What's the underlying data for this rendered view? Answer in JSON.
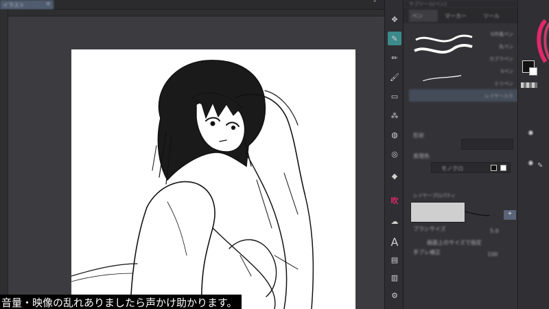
{
  "document_tab": {
    "title": "イラスト"
  },
  "toolbar": {
    "tools": [
      "move-tool-icon",
      "pen-tool-icon",
      "pencil-tool-icon",
      "brush-tool-icon",
      "eraser-tool-icon",
      "airbrush-tool-icon",
      "blend-tool-icon",
      "lasso-tool-icon",
      "eyedropper-tool-icon",
      "fill-tool-icon",
      "pattern-tool-icon",
      "stamp-tool-icon",
      "text-tool-icon",
      "balloon-tool-icon",
      "ruler-tool-icon",
      "frame-tool-icon",
      "correction-tool-icon"
    ],
    "text_tool_glyph": "A",
    "balloon_tool_glyph": "吹"
  },
  "brush_panel": {
    "title": "サブツール[ペン]",
    "tabs": [
      {
        "label": "ペン",
        "active": true
      },
      {
        "label": "マーカー",
        "active": false
      },
      {
        "label": "ツール",
        "active": false
      }
    ],
    "brushes": [
      {
        "label": "G作風ペン",
        "selected": false
      },
      {
        "label": "丸ペン",
        "selected": false
      },
      {
        "label": "カブラペン",
        "selected": false
      },
      {
        "label": "Sペン",
        "selected": false
      },
      {
        "label": "ミリペン",
        "selected": false
      },
      {
        "label": "レイヤー入り",
        "selected": true
      }
    ]
  },
  "tool_property": {
    "shape_label": "形状",
    "color_label": "表現色",
    "color_value": "モノクロ",
    "preset_name": "レイヤープロパティ",
    "brush_size_label": "ブラシサイズ",
    "brush_size_value": "5.0",
    "fit_size_label": "画面上のサイズで指定",
    "stabilization_label": "手ブレ補正",
    "stabilization_value": "100"
  },
  "subtitle": "音量・映像の乱れありましたら声かけ助かります。",
  "colors": {
    "accent_active_tool": "#3d8a8c",
    "selected_brush": "#4a5566",
    "color_wheel_edge": "#e0286a"
  }
}
